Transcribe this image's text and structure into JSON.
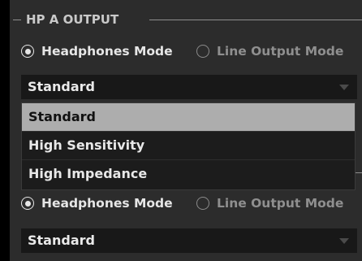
{
  "section_a": {
    "title": "HP A OUTPUT",
    "mode_options": [
      {
        "label": "Headphones Mode",
        "selected": true
      },
      {
        "label": "Line Output Mode",
        "selected": false
      }
    ],
    "dropdown_value": "Standard"
  },
  "menu": {
    "items": [
      {
        "label": "Standard",
        "selected": true
      },
      {
        "label": "High Sensitivity",
        "selected": false
      },
      {
        "label": "High Impedance",
        "selected": false
      }
    ]
  },
  "section_b": {
    "mode_options": [
      {
        "label": "Headphones Mode",
        "selected": true
      },
      {
        "label": "Line Output Mode",
        "selected": false
      }
    ],
    "dropdown_value": "Standard"
  },
  "colors": {
    "panel_bg": "#2c2c2c",
    "field_bg": "#181818",
    "menu_selected_bg": "#adadad",
    "text": "#e6e6e6",
    "dim_text": "#8f8f8f"
  }
}
